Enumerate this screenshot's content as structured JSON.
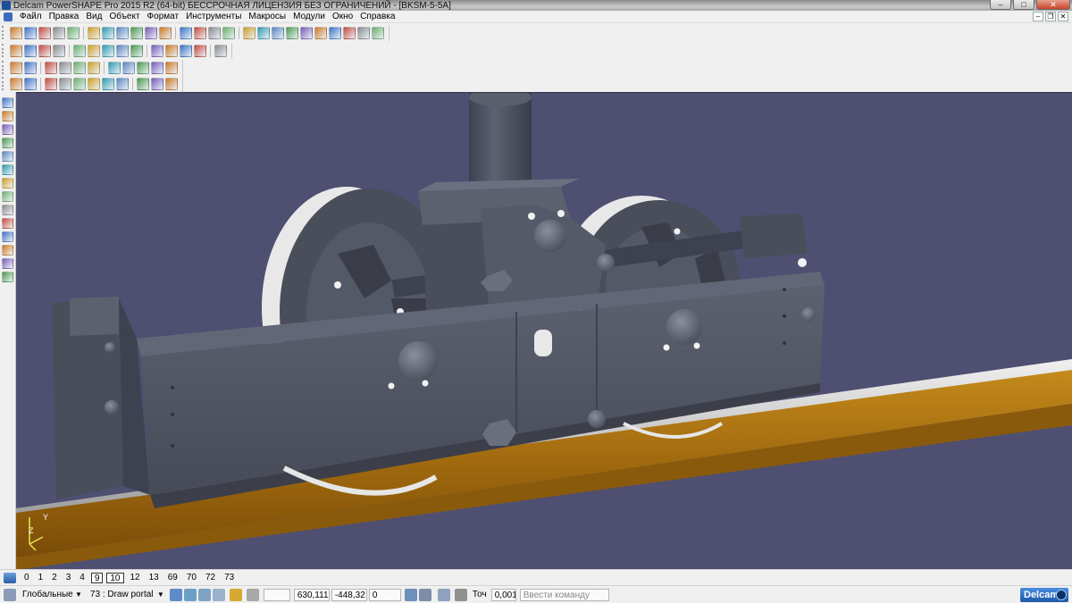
{
  "window": {
    "title": "Delcam PowerSHAPE Pro 2015 R2 (64-bit) БЕССРОЧНАЯ ЛИЦЕНЗИЯ БЕЗ ОГРАНИЧЕНИЙ - [BKSM-5-5A]",
    "min": "–",
    "max": "□",
    "close": "✕"
  },
  "menu": {
    "items": [
      "Файл",
      "Правка",
      "Вид",
      "Объект",
      "Формат",
      "Инструменты",
      "Макросы",
      "Модули",
      "Окно",
      "Справка"
    ],
    "mdi_min": "–",
    "mdi_restore": "❐",
    "mdi_close": "✕"
  },
  "toolbars": {
    "row1_icons": [
      "quick-select-icon",
      "new-file-icon",
      "open-file-icon",
      "open-recent-icon",
      "save-icon",
      "print-icon",
      "cut-icon",
      "copy-icon",
      "paste-icon",
      "eraser-icon",
      "delete-icon",
      "undo-icon",
      "redo-icon",
      "repeat-icon",
      "dimension-icon",
      "point-icon",
      "line-icon",
      "arc-icon",
      "circle-icon",
      "curve-icon",
      "wireframe-icon",
      "surface-icon",
      "solid-icon",
      "symbol-icon",
      "wrench-icon"
    ],
    "row2_icons": [
      "close-icon",
      "view-top-icon",
      "view-front-icon",
      "view-iso-icon",
      "zoom-window-icon",
      "zoom-in-icon",
      "zoom-out-icon",
      "rotate-icon",
      "pan-icon",
      "globe-icon",
      "shaded-icon",
      "wireframe-shade-icon",
      "lightbulb-icon",
      "tools-icon"
    ],
    "row3_icons": [
      "drawing-icon",
      "model-icon",
      "red-sphere-icon",
      "green-sphere-icon",
      "yellow-sphere-icon",
      "cone-icon",
      "box-icon",
      "cylinder-icon",
      "torus-icon",
      "spring-icon",
      "revolve-icon"
    ],
    "row4_icons": [
      "sphere-icon",
      "edit-icon",
      "extrude-icon",
      "block-icon",
      "fillet-icon",
      "chamfer-icon",
      "boolean-icon",
      "shell-icon",
      "trim-icon",
      "offset-icon",
      "draft-icon"
    ]
  },
  "left_toolbar_icons": [
    "select-arrow-icon",
    "layers-icon",
    "dot-line-icon",
    "warning-icon",
    "measure-icon",
    "mirror-icon",
    "copy-move-icon",
    "scale-icon",
    "rotate-object-icon",
    "morph-icon",
    "analysis-icon",
    "repair-icon",
    "colour-icon",
    "pcb-icon"
  ],
  "viewport": {
    "background": "#4f4f71",
    "axis_label_y": "Y",
    "axis_label_z": "Z"
  },
  "layers": {
    "items": [
      "0",
      "1",
      "2",
      "3",
      "4",
      "9",
      "10",
      "12",
      "13",
      "69",
      "70",
      "72",
      "73"
    ],
    "active": [
      "9",
      "10"
    ]
  },
  "status": {
    "workplane": "Глобальные",
    "level": "73 : Draw portal",
    "x": "630,111",
    "y": "-448,32",
    "z": "0",
    "tolerance_label": "Точ",
    "tolerance_value": "0,001",
    "command_placeholder": "Ввести команду",
    "logo": "Delcam"
  },
  "colors": {
    "rail": "#b07814",
    "frame": "#505566",
    "wheel_light": "#ececec"
  }
}
